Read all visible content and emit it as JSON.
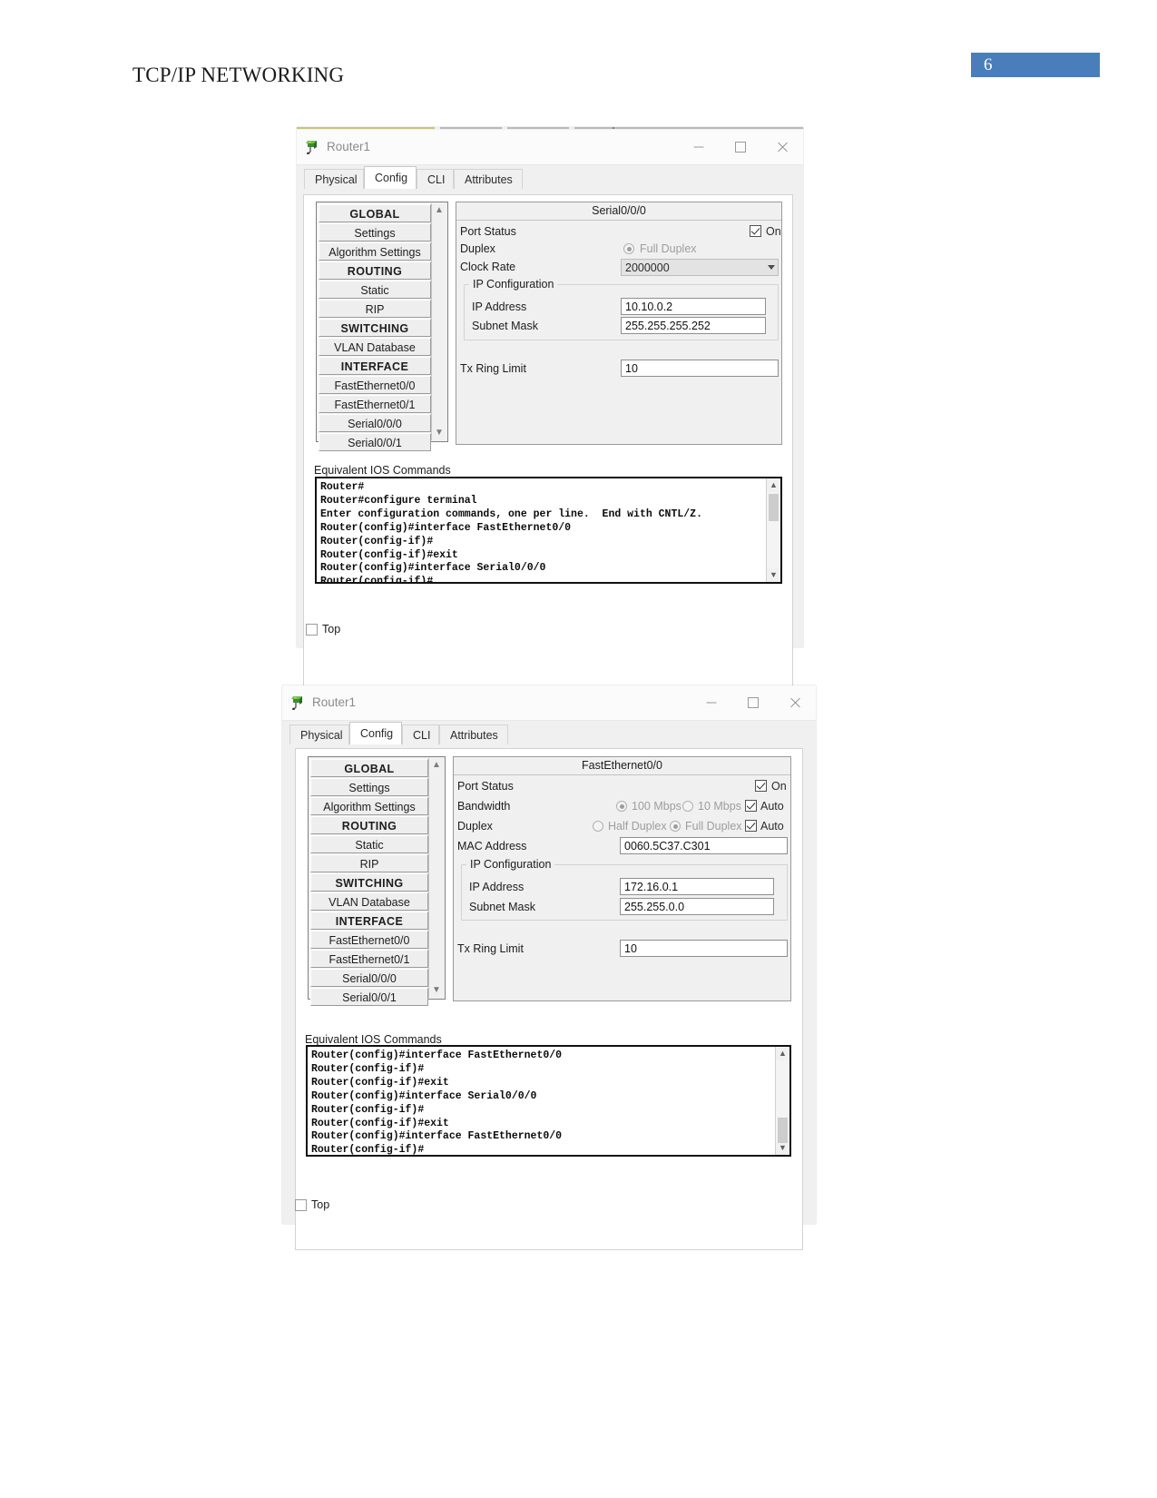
{
  "document": {
    "title": "TCP/IP NETWORKING",
    "page_number": "6",
    "page_badge_color": "#4a7ebb"
  },
  "windows": [
    {
      "title": "Router1",
      "icon": "packet-tracer-router-icon",
      "controls": {
        "minimize": "minimize-icon",
        "maximize": "maximize-icon",
        "close": "close-icon"
      },
      "tabs": [
        {
          "label": "Physical",
          "active": false
        },
        {
          "label": "Config",
          "active": true
        },
        {
          "label": "CLI",
          "active": false
        },
        {
          "label": "Attributes",
          "active": false
        }
      ],
      "tree": [
        {
          "label": "GLOBAL",
          "group": true
        },
        {
          "label": "Settings",
          "group": false
        },
        {
          "label": "Algorithm Settings",
          "group": false
        },
        {
          "label": "ROUTING",
          "group": true
        },
        {
          "label": "Static",
          "group": false
        },
        {
          "label": "RIP",
          "group": false
        },
        {
          "label": "SWITCHING",
          "group": true
        },
        {
          "label": "VLAN Database",
          "group": false
        },
        {
          "label": "INTERFACE",
          "group": true
        },
        {
          "label": "FastEthernet0/0",
          "group": false
        },
        {
          "label": "FastEthernet0/1",
          "group": false
        },
        {
          "label": "Serial0/0/0",
          "group": false
        },
        {
          "label": "Serial0/0/1",
          "group": false
        }
      ],
      "panel": {
        "header": "Serial0/0/0",
        "port_status_label": "Port Status",
        "port_status_on_label": "On",
        "port_status_on_checked": true,
        "duplex_label": "Duplex",
        "duplex_full_label": "Full Duplex",
        "clock_rate_label": "Clock Rate",
        "clock_rate_value": "2000000",
        "ip_config_title": "IP Configuration",
        "ip_address_label": "IP Address",
        "ip_address_value": "10.10.0.2",
        "subnet_mask_label": "Subnet Mask",
        "subnet_mask_value": "255.255.255.252",
        "tx_ring_limit_label": "Tx Ring Limit",
        "tx_ring_limit_value": "10"
      },
      "ios": {
        "label": "Equivalent IOS Commands",
        "text": "Router#\nRouter#configure terminal\nEnter configuration commands, one per line.  End with CNTL/Z.\nRouter(config)#interface FastEthernet0/0\nRouter(config-if)#\nRouter(config-if)#exit\nRouter(config)#interface Serial0/0/0\nRouter(config-if)#"
      },
      "bottom": {
        "top_label": "Top",
        "top_checked": false
      }
    },
    {
      "title": "Router1",
      "icon": "packet-tracer-router-icon",
      "controls": {
        "minimize": "minimize-icon",
        "maximize": "maximize-icon",
        "close": "close-icon"
      },
      "tabs": [
        {
          "label": "Physical",
          "active": false
        },
        {
          "label": "Config",
          "active": true
        },
        {
          "label": "CLI",
          "active": false
        },
        {
          "label": "Attributes",
          "active": false
        }
      ],
      "tree": [
        {
          "label": "GLOBAL",
          "group": true
        },
        {
          "label": "Settings",
          "group": false
        },
        {
          "label": "Algorithm Settings",
          "group": false
        },
        {
          "label": "ROUTING",
          "group": true
        },
        {
          "label": "Static",
          "group": false
        },
        {
          "label": "RIP",
          "group": false
        },
        {
          "label": "SWITCHING",
          "group": true
        },
        {
          "label": "VLAN Database",
          "group": false
        },
        {
          "label": "INTERFACE",
          "group": true
        },
        {
          "label": "FastEthernet0/0",
          "group": false
        },
        {
          "label": "FastEthernet0/1",
          "group": false
        },
        {
          "label": "Serial0/0/0",
          "group": false
        },
        {
          "label": "Serial0/0/1",
          "group": false
        }
      ],
      "panel": {
        "header": "FastEthernet0/0",
        "port_status_label": "Port Status",
        "port_status_on_label": "On",
        "port_status_on_checked": true,
        "bandwidth_label": "Bandwidth",
        "bandwidth_100_label": "100 Mbps",
        "bandwidth_10_label": "10 Mbps",
        "bandwidth_auto_label": "Auto",
        "bandwidth_auto_checked": true,
        "duplex_label": "Duplex",
        "duplex_half_label": "Half Duplex",
        "duplex_full_label": "Full Duplex",
        "duplex_auto_label": "Auto",
        "duplex_auto_checked": true,
        "mac_address_label": "MAC Address",
        "mac_address_value": "0060.5C37.C301",
        "ip_config_title": "IP Configuration",
        "ip_address_label": "IP Address",
        "ip_address_value": "172.16.0.1",
        "subnet_mask_label": "Subnet Mask",
        "subnet_mask_value": "255.255.0.0",
        "tx_ring_limit_label": "Tx Ring Limit",
        "tx_ring_limit_value": "10"
      },
      "ios": {
        "label": "Equivalent IOS Commands",
        "text": "Router(config)#interface FastEthernet0/0\nRouter(config-if)#\nRouter(config-if)#exit\nRouter(config)#interface Serial0/0/0\nRouter(config-if)#\nRouter(config-if)#exit\nRouter(config)#interface FastEthernet0/0\nRouter(config-if)#"
      },
      "bottom": {
        "top_label": "Top",
        "top_checked": false
      }
    }
  ]
}
